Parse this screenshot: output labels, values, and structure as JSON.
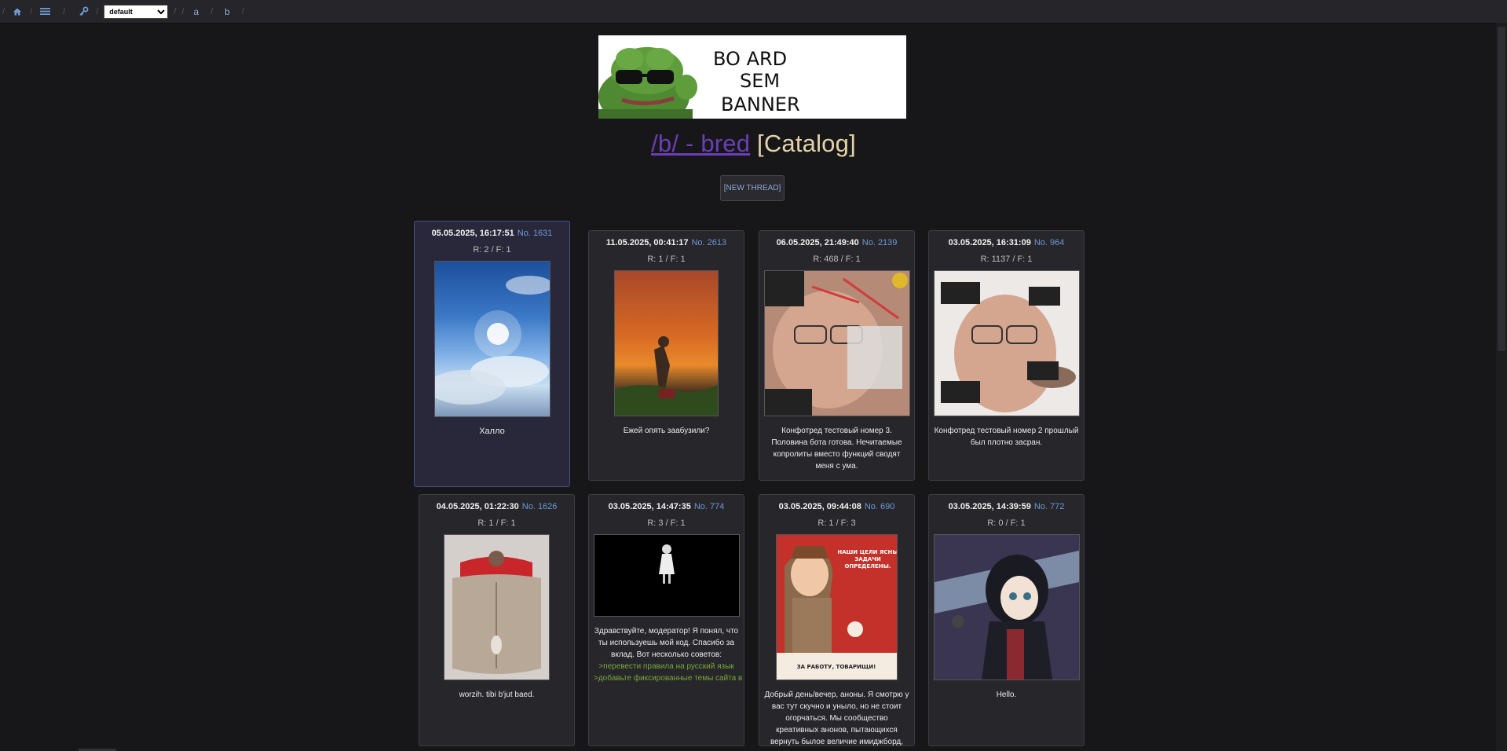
{
  "topbar": {
    "home_icon": "home-icon",
    "menu_icon": "hamburger-menu-icon",
    "key_icon": "key-icon",
    "style_select_value": "default",
    "board_links": [
      "a",
      "b"
    ],
    "separator": "/"
  },
  "banner": {
    "text_lines": [
      "BO ARD",
      "SEM",
      "BANNER"
    ]
  },
  "header": {
    "board_link": "/b/ - bred",
    "catalog_label": "[Catalog]",
    "new_thread_label": "[NEW THREAD]"
  },
  "threads": [
    {
      "date": "05.05.2025, 16:17:51",
      "no": "No. 1631",
      "stats": "R: 2 / F: 1",
      "text": "Халло",
      "highlighted": true
    },
    {
      "date": "11.05.2025, 00:41:17",
      "no": "No. 2613",
      "stats": "R: 1 / F: 1",
      "text": "Ежей опять заабузили?"
    },
    {
      "date": "06.05.2025, 21:49:40",
      "no": "No. 2139",
      "stats": "R: 468 / F: 1",
      "text": "Конфотред тестовый номер 3. Половина бота готова. Нечитаемые копролиты вместо функций сводят меня с ума."
    },
    {
      "date": "03.05.2025, 16:31:09",
      "no": "No. 964",
      "stats": "R: 1137 / F: 1",
      "text": "Конфотред тестовый номер 2 прошлый был плотно засран."
    },
    {
      "date": "04.05.2025, 01:22:30",
      "no": "No. 1626",
      "stats": "R: 1 / F: 1",
      "text": "worzih. tibi b'jut baed."
    },
    {
      "date": "03.05.2025, 14:47:35",
      "no": "No. 774",
      "stats": "R: 3 / F: 1",
      "text": "Здравствуйте, модератор! Я понял, что ты используешь мой код. Спасибо за вклад. Вот несколько советов:",
      "quotes": [
        ">перевести правила на русский язык",
        ">добавьте фиксированные темы сайта в"
      ]
    },
    {
      "date": "03.05.2025, 09:44:08",
      "no": "No. 690",
      "stats": "R: 1 / F: 3",
      "text": "Добрый день/вечер, аноны. Я смотрю у вас тут скучно и уныло, но не стоит огорчаться. Мы сообщество креативных анонов, пытающихся вернуть былое величие имиджборд, приглашаем вас на",
      "poster_text_top": "НАШИ ЦЕЛИ ЯСНЫ ЗАДАЧИ ОПРЕДЕЛЕНЫ.",
      "poster_text_bottom": "ЗА РАБОТУ, ТОВАРИЩИ!"
    },
    {
      "date": "03.05.2025, 14:39:59",
      "no": "No. 772",
      "stats": "R: 0 / F: 1",
      "text": "Hello."
    }
  ]
}
